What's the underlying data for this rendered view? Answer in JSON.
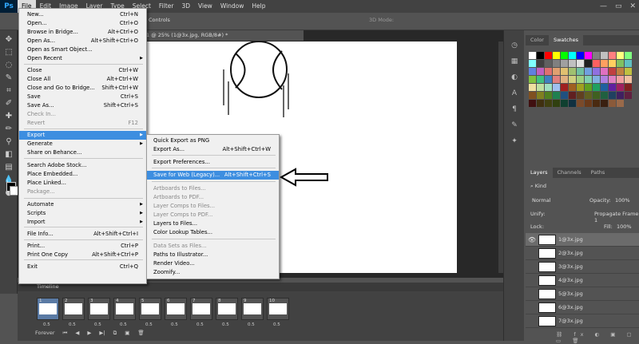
{
  "menubar": {
    "logo": "Ps",
    "items": [
      "File",
      "Edit",
      "Image",
      "Layer",
      "Type",
      "Select",
      "Filter",
      "3D",
      "View",
      "Window",
      "Help"
    ],
    "window_controls": [
      "—",
      "▭",
      "✕"
    ]
  },
  "options": {
    "controls_label": "Controls",
    "mode_3d": "3D Mode:"
  },
  "document": {
    "tab_title": "1 @ 25% (1@3x.jpg, RGB/8#) *"
  },
  "file_menu": {
    "items": [
      {
        "label": "New...",
        "shortcut": "Ctrl+N"
      },
      {
        "label": "Open...",
        "shortcut": "Ctrl+O"
      },
      {
        "label": "Browse in Bridge...",
        "shortcut": "Alt+Ctrl+O"
      },
      {
        "label": "Open As...",
        "shortcut": "Alt+Shift+Ctrl+O"
      },
      {
        "label": "Open as Smart Object...",
        "shortcut": ""
      },
      {
        "label": "Open Recent",
        "shortcut": ""
      },
      {
        "label": "Close",
        "shortcut": "Ctrl+W"
      },
      {
        "label": "Close All",
        "shortcut": "Alt+Ctrl+W"
      },
      {
        "label": "Close and Go to Bridge...",
        "shortcut": "Shift+Ctrl+W"
      },
      {
        "label": "Save",
        "shortcut": "Ctrl+S"
      },
      {
        "label": "Save As...",
        "shortcut": "Shift+Ctrl+S"
      },
      {
        "label": "Check In...",
        "shortcut": ""
      },
      {
        "label": "Revert",
        "shortcut": "F12"
      },
      {
        "label": "Export",
        "shortcut": ""
      },
      {
        "label": "Generate",
        "shortcut": ""
      },
      {
        "label": "Share on Behance...",
        "shortcut": ""
      },
      {
        "label": "Search Adobe Stock...",
        "shortcut": ""
      },
      {
        "label": "Place Embedded...",
        "shortcut": ""
      },
      {
        "label": "Place Linked...",
        "shortcut": ""
      },
      {
        "label": "Package...",
        "shortcut": ""
      },
      {
        "label": "Automate",
        "shortcut": ""
      },
      {
        "label": "Scripts",
        "shortcut": ""
      },
      {
        "label": "Import",
        "shortcut": ""
      },
      {
        "label": "File Info...",
        "shortcut": "Alt+Shift+Ctrl+I"
      },
      {
        "label": "Print...",
        "shortcut": "Ctrl+P"
      },
      {
        "label": "Print One Copy",
        "shortcut": "Alt+Shift+Ctrl+P"
      },
      {
        "label": "Exit",
        "shortcut": "Ctrl+Q"
      }
    ]
  },
  "export_menu": {
    "items": [
      {
        "label": "Quick Export as PNG",
        "shortcut": ""
      },
      {
        "label": "Export As...",
        "shortcut": "Alt+Shift+Ctrl+W"
      },
      {
        "label": "Export Preferences...",
        "shortcut": ""
      },
      {
        "label": "Save for Web (Legacy)...",
        "shortcut": "Alt+Shift+Ctrl+S"
      },
      {
        "label": "Artboards to Files...",
        "shortcut": ""
      },
      {
        "label": "Artboards to PDF...",
        "shortcut": ""
      },
      {
        "label": "Layer Comps to Files...",
        "shortcut": ""
      },
      {
        "label": "Layer Comps to PDF...",
        "shortcut": ""
      },
      {
        "label": "Layers to Files...",
        "shortcut": ""
      },
      {
        "label": "Color Lookup Tables...",
        "shortcut": ""
      },
      {
        "label": "Data Sets as Files...",
        "shortcut": ""
      },
      {
        "label": "Paths to Illustrator...",
        "shortcut": ""
      },
      {
        "label": "Render Video...",
        "shortcut": ""
      },
      {
        "label": "Zoomify...",
        "shortcut": ""
      }
    ]
  },
  "swatches": {
    "tabs": [
      "Color",
      "Swatches"
    ],
    "colors": [
      "#ffffff",
      "#000000",
      "#ff0000",
      "#ffff00",
      "#00ff00",
      "#00ffff",
      "#0000ff",
      "#ff00ff",
      "#808080",
      "#c0c0c0",
      "#ff8080",
      "#ffff80",
      "#80ff80",
      "#80ffff",
      "#404040",
      "#606060",
      "#808080",
      "#a0a0a0",
      "#c0c0c0",
      "#e0e0e0",
      "#202020",
      "#ff6060",
      "#ffa060",
      "#ffd060",
      "#80c060",
      "#60c0c0",
      "#6080e0",
      "#c060c0",
      "#e07070",
      "#e0a070",
      "#e0c070",
      "#a0c070",
      "#70c0a0",
      "#70a0e0",
      "#9070e0",
      "#e070c0",
      "#c04040",
      "#c08040",
      "#c0c040",
      "#80c040",
      "#40c080",
      "#4080c0",
      "#e08080",
      "#e0b080",
      "#d0d080",
      "#a0d080",
      "#80d0b0",
      "#80b0e0",
      "#b080e0",
      "#e080c0",
      "#f0a0a0",
      "#f0c0a0",
      "#f0e0a0",
      "#c0e0a0",
      "#a0e0c0",
      "#a0c0f0",
      "#a02020",
      "#a06020",
      "#a0a020",
      "#60a020",
      "#20a060",
      "#2060a0",
      "#6020a0",
      "#a02060",
      "#802020",
      "#805020",
      "#808020",
      "#508020",
      "#208050",
      "#205080",
      "#602020",
      "#604020",
      "#606020",
      "#406020",
      "#206040",
      "#204060",
      "#402060",
      "#602040",
      "#401010",
      "#403010",
      "#404010",
      "#304010",
      "#104030",
      "#103040",
      "#7a4a2a",
      "#6a3a1a",
      "#4a2a10",
      "#3a2010",
      "#8a5a3a",
      "#9a6a4a"
    ]
  },
  "layers": {
    "tabs": [
      "Layers",
      "Channels",
      "Paths"
    ],
    "kind": "Kind",
    "blend": "Normal",
    "opacity_label": "Opacity:",
    "opacity": "100%",
    "unify": "Unify:",
    "propagate": "Propagate Frame 1",
    "lock": "Lock:",
    "fill_label": "Fill:",
    "fill": "100%",
    "items": [
      "1@3x.jpg",
      "2@3x.jpg",
      "3@3x.jpg",
      "4@3x.jpg",
      "5@3x.jpg",
      "6@3x.jpg",
      "7@3x.jpg"
    ]
  },
  "timeline": {
    "title": "Timeline",
    "frames": [
      "1",
      "2",
      "3",
      "4",
      "5",
      "6",
      "7",
      "8",
      "9",
      "10"
    ],
    "frame_time": "0.5",
    "loop": "Forever"
  }
}
